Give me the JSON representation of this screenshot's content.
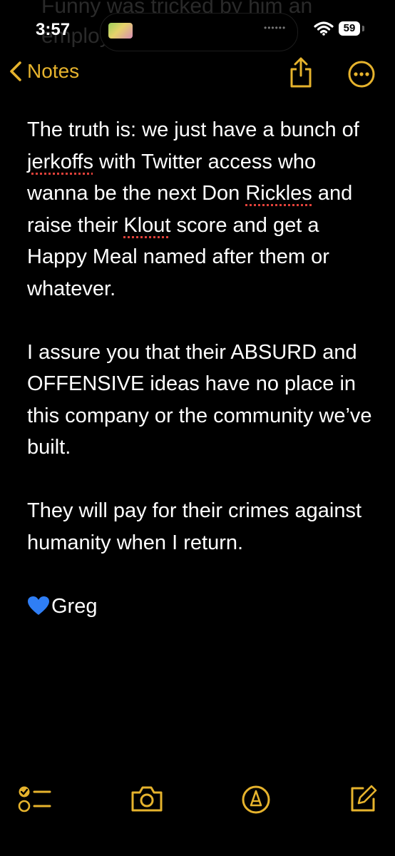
{
  "status_bar": {
    "time": "3:57",
    "battery": "59",
    "ghost_lines": [
      "Funny was tricked by him an",
      "employees his conduct"
    ]
  },
  "nav": {
    "back_label": "Notes",
    "accent_color": "#e6b32d"
  },
  "note": {
    "paragraph1": {
      "t1": "The truth is: we just have a bunch of ",
      "w1": "jerkoffs",
      "t2": " with Twitter access who wanna be the next Don ",
      "w2": "Rickles",
      "t3": " and raise their ",
      "w3": "Klout",
      "t4": " score and get a Happy Meal named after them or whatever."
    },
    "paragraph2": "I assure you that their ABSURD and OFFENSIVE ideas have no place in this company or the community we’ve built.",
    "paragraph3": "They will pay for their crimes against humanity when I return.",
    "signature": "Greg",
    "signature_icon": "blue-heart-icon"
  },
  "toolbar": {
    "icons": [
      "checklist-icon",
      "camera-icon",
      "markup-pen-icon",
      "compose-icon"
    ]
  }
}
